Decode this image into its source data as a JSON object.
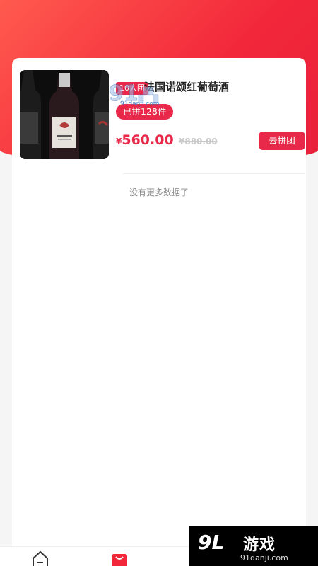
{
  "product": {
    "group_badge": "10人团",
    "title": "法国诺颂红葡萄酒",
    "joined": "已拼128件",
    "price_symbol": "¥",
    "price": "560.00",
    "original_price": "¥880.00",
    "action": "去拼团"
  },
  "list": {
    "end_text": "没有更多数据了"
  },
  "watermark": {
    "url": "91danji.com"
  },
  "brand": {
    "name": "游戏",
    "url": "91danji.com"
  },
  "tabbar": {
    "icons": [
      "home-icon",
      "shopping-bag-icon",
      "basket-icon"
    ]
  },
  "colors": {
    "accent": "#e8294a",
    "hero": "#f2273a"
  }
}
